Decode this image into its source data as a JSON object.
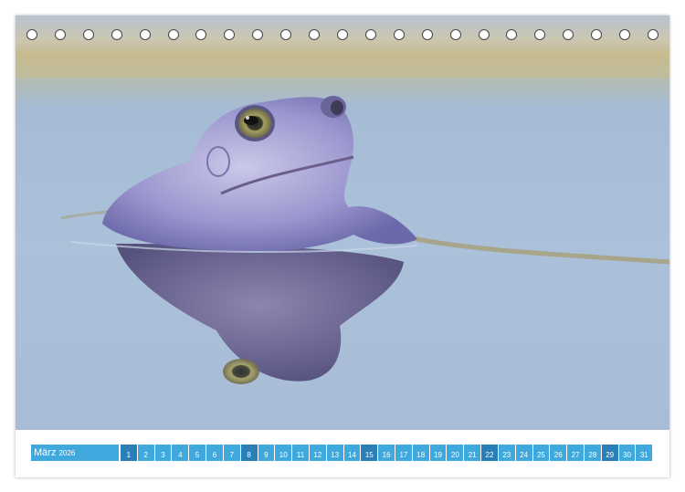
{
  "calendar": {
    "month": "März",
    "year": "2026",
    "days": [
      "1",
      "2",
      "3",
      "4",
      "5",
      "6",
      "7",
      "8",
      "9",
      "10",
      "11",
      "12",
      "13",
      "14",
      "15",
      "16",
      "17",
      "18",
      "19",
      "20",
      "21",
      "22",
      "23",
      "24",
      "25",
      "26",
      "27",
      "28",
      "29",
      "30",
      "31"
    ],
    "weekend_days": [
      "1",
      "8",
      "15",
      "22",
      "29"
    ],
    "colors": {
      "accent": "#3fa8dc",
      "weekend": "#2a7fb7"
    }
  },
  "photo": {
    "subject": "frog-in-water"
  },
  "binding_holes": 23
}
